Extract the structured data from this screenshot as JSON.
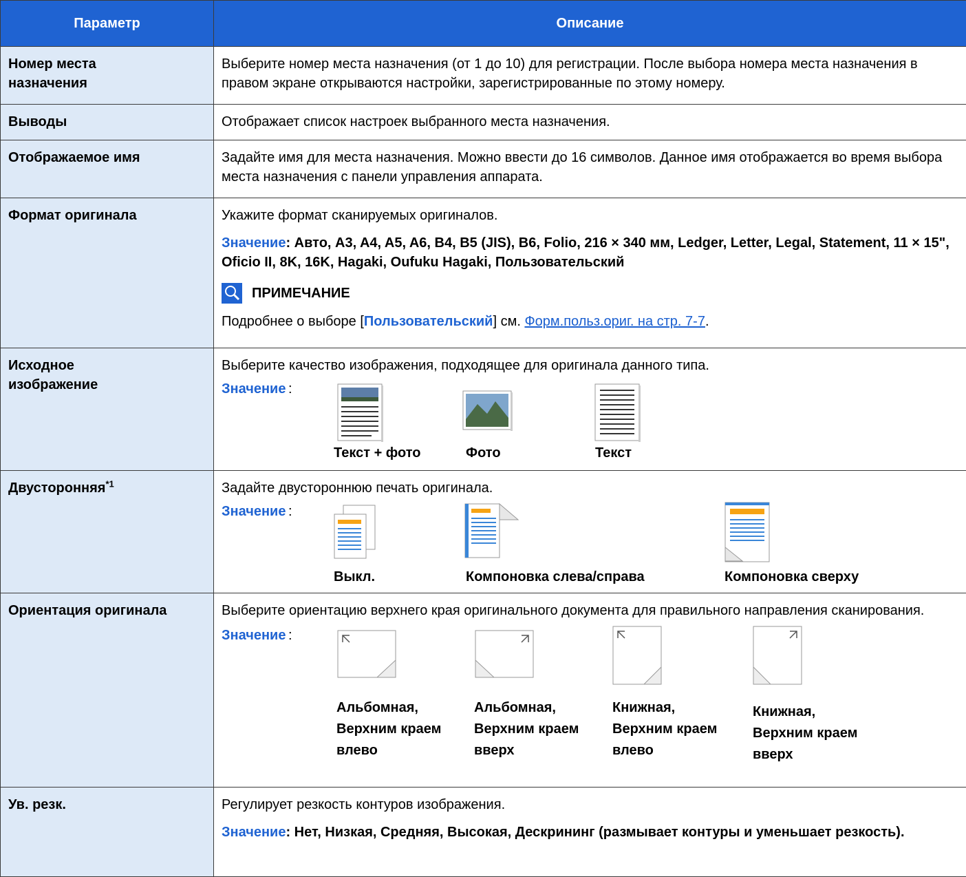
{
  "table": {
    "headers": {
      "param": "Параметр",
      "desc": "Описание"
    },
    "rows": {
      "dest_number": {
        "name": "Номер места назначения",
        "desc": "Выберите номер места назначения (от 1 до 10) для регистрации. После выбора номера места назначения в правом экране открываются настройки, зарегистрированные по этому номеру."
      },
      "outputs": {
        "name": "Выводы",
        "desc": "Отображает список настроек выбранного места назначения."
      },
      "display_name": {
        "name": "Отображаемое имя",
        "desc": "Задайте имя для места назначения. Можно ввести до 16 символов. Данное имя отображается во время выбора места назначения с панели управления аппарата."
      },
      "orig_format": {
        "name": "Формат оригинала",
        "desc": "Укажите формат сканируемых оригиналов.",
        "value_label": "Значение",
        "values": ": Авто, A3, A4, A5, A6, B4, B5 (JIS), B6, Folio, 216 × 340 мм, Ledger, Letter, Legal, Statement, 11 × 15\", Oficio II, 8K, 16K, Hagaki, Oufuku Hagaki, Пользовательский",
        "note_title": "ПРИМЕЧАНИЕ",
        "note_pre": "Подробнее о выборе [",
        "note_bold": "Пользовательский",
        "note_mid": "] см. ",
        "note_link": "Форм.польз.ориг. на стр. 7-7",
        "note_end": "."
      },
      "orig_image": {
        "name": "Исходное изображение",
        "desc": "Выберите качество изображения, подходящее для оригинала данного типа.",
        "value_label": "Значение",
        "options": [
          "Текст + фото",
          "Фото",
          "Текст"
        ]
      },
      "duplex": {
        "name": "Двусторонняя",
        "sup": "*1",
        "desc": "Задайте двустороннюю печать оригинала.",
        "value_label": "Значение",
        "options": [
          "Выкл.",
          "Компоновка слева/справа",
          "Компоновка сверху"
        ]
      },
      "orientation": {
        "name": "Ориентация оригинала",
        "desc": "Выберите ориентацию верхнего края оригинального документа для правильного направления сканирования.",
        "value_label": "Значение",
        "options": [
          [
            "Альбомная,",
            "Верхним краем",
            "влево"
          ],
          [
            "Альбомная,",
            "Верхним краем",
            "вверх"
          ],
          [
            "Книжная,",
            "Верхним краем",
            "влево"
          ],
          [
            "Книжная,",
            "Верхним краем",
            "вверх"
          ]
        ]
      },
      "sharpness": {
        "name": "Ув. резк.",
        "desc": "Регулирует резкость контуров изображения.",
        "value_label": "Значение",
        "values": ": Нет, Низкая, Средняя, Высокая, Дескрининг (размывает контуры и уменьшает резкость)."
      }
    }
  },
  "colors": {
    "header_bg": "#1f63d2",
    "param_bg": "#dde9f7",
    "value_label": "#1f63d2",
    "icon_orange": "#f6a313",
    "icon_blue": "#3a86d8"
  }
}
